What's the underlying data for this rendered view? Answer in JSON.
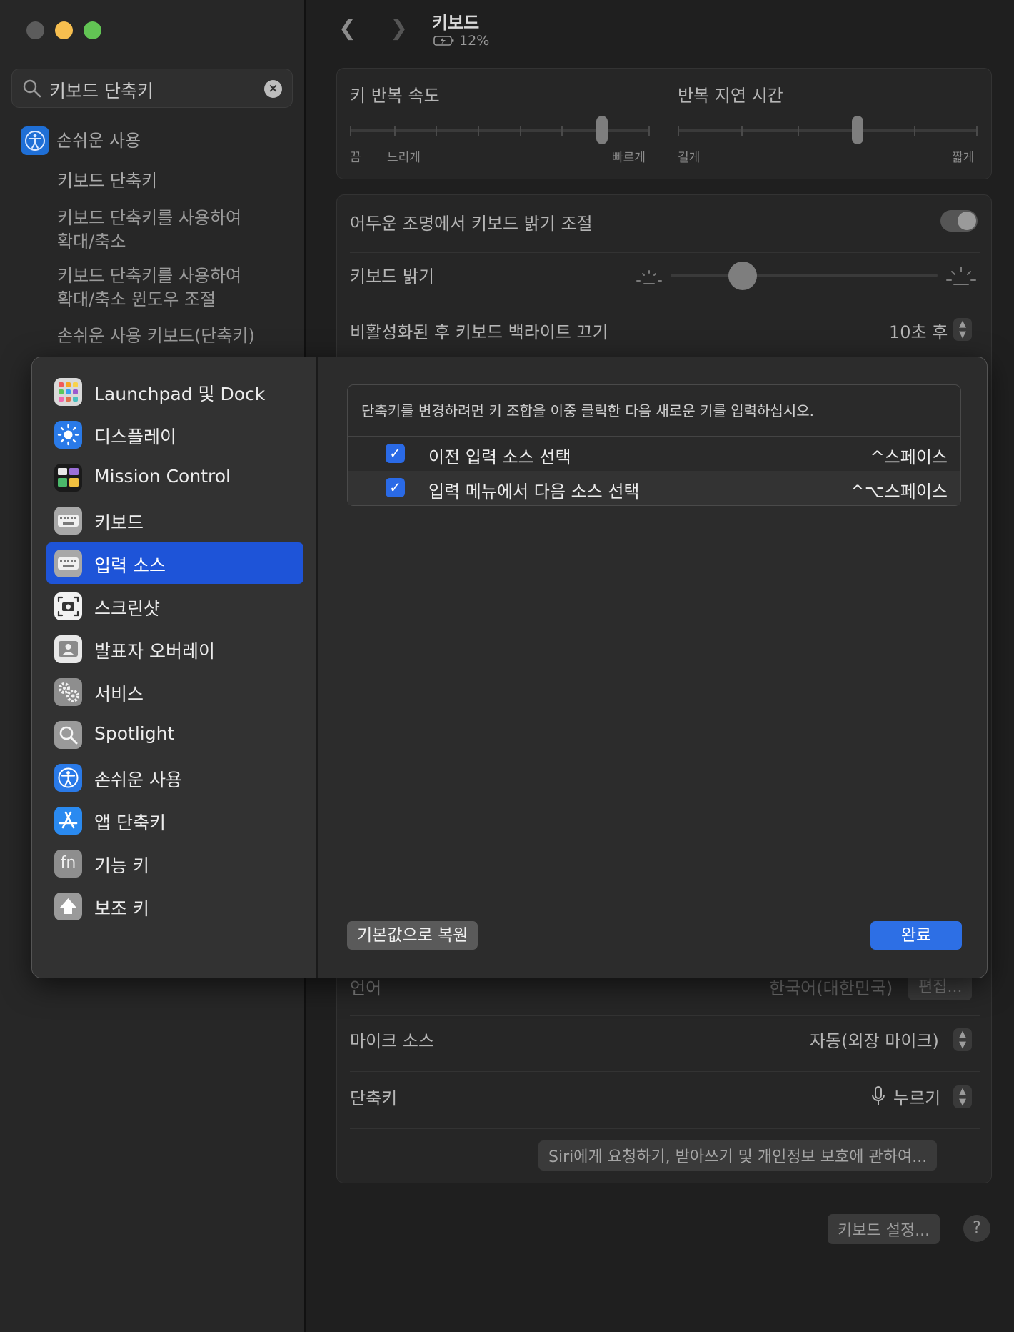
{
  "sidebar": {
    "search_value": "키보드 단축키",
    "group_label": "손쉬운 사용",
    "results": [
      "키보드 단축키",
      "키보드 단축키를 사용하여\n확대/축소",
      "키보드 단축키를 사용하여\n확대/축소 윈도우 조절",
      "손쉬운 사용 키보드(단축키)"
    ]
  },
  "header": {
    "title": "키보드",
    "battery": "12%"
  },
  "key_repeat": {
    "rate_label": "키 반복 속도",
    "rate_min": "끔",
    "rate_slow": "느리게",
    "rate_max": "빠르게",
    "rate_value_fraction": 0.84,
    "delay_label": "반복 지연 시간",
    "delay_min": "길게",
    "delay_max": "짧게",
    "delay_value_fraction": 0.6
  },
  "backlight": {
    "auto_adjust_label": "어두운 조명에서 키보드 밝기 조절",
    "auto_adjust_on": true,
    "brightness_label": "키보드 밝기",
    "brightness_fraction": 0.27,
    "turn_off_label": "비활성화된 후 키보드 백라이트 끄기",
    "turn_off_value": "10초 후"
  },
  "dictation": {
    "language_label": "언어",
    "language_value": "한국어(대한민국)",
    "language_edit": "편집...",
    "mic_label": "마이크 소스",
    "mic_value": "자동(외장 마이크)",
    "shortcut_label": "단축키",
    "shortcut_value": "누르기",
    "about_button": "Siri에게 요청하기, 받아쓰기 및 개인정보 보호에 관하여..."
  },
  "footer": {
    "keyboard_settings": "키보드 설정...",
    "help": "?"
  },
  "modal": {
    "categories": [
      {
        "label": "Launchpad 및 Dock",
        "icon": "launchpad-icon"
      },
      {
        "label": "디스플레이",
        "icon": "display-brightness-icon"
      },
      {
        "label": "Mission Control",
        "icon": "mission-control-icon"
      },
      {
        "label": "키보드",
        "icon": "keyboard-icon"
      },
      {
        "label": "입력 소스",
        "icon": "input-sources-icon"
      },
      {
        "label": "스크린샷",
        "icon": "screenshot-icon"
      },
      {
        "label": "발표자 오버레이",
        "icon": "presenter-overlay-icon"
      },
      {
        "label": "서비스",
        "icon": "services-gear-icon"
      },
      {
        "label": "Spotlight",
        "icon": "spotlight-icon"
      },
      {
        "label": "손쉬운 사용",
        "icon": "accessibility-icon"
      },
      {
        "label": "앱 단축키",
        "icon": "app-shortcuts-icon"
      },
      {
        "label": "기능 키",
        "icon": "function-keys-icon"
      },
      {
        "label": "보조 키",
        "icon": "modifier-keys-icon"
      }
    ],
    "selected_index": 4,
    "hint": "단축키를 변경하려면 키 조합을 이중 클릭한 다음 새로운 키를 입력하십시오.",
    "shortcuts": [
      {
        "label": "이전 입력 소스 선택",
        "keys": "^스페이스",
        "checked": true
      },
      {
        "label": "입력 메뉴에서 다음 소스 선택",
        "keys": "^⌥스페이스",
        "checked": true
      }
    ],
    "restore_button": "기본값으로 복원",
    "done_button": "완료"
  },
  "colors": {
    "accent": "#1e54d8",
    "done": "#2d6fe5",
    "checkbox": "#2a6ae6"
  }
}
